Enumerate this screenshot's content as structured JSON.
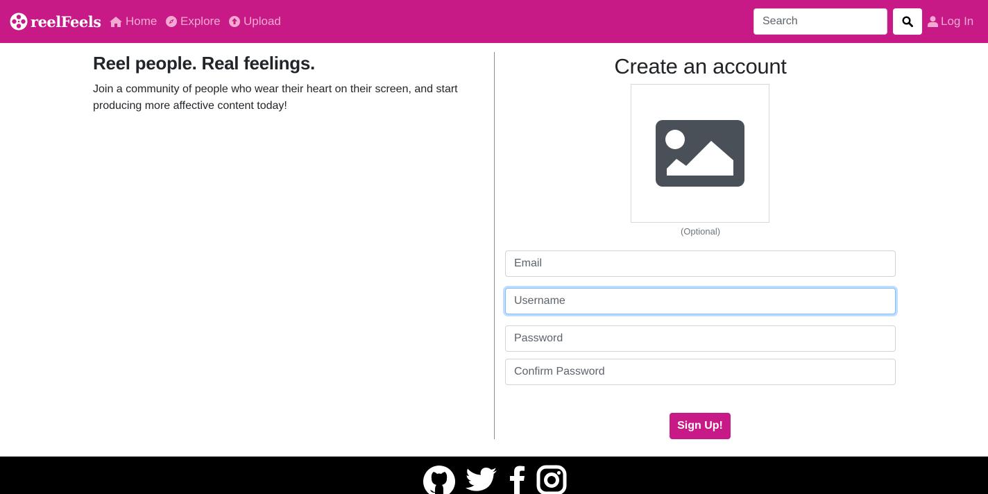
{
  "brand": {
    "name": "reelFeels"
  },
  "nav": {
    "home": "Home",
    "explore": "Explore",
    "upload": "Upload",
    "search_placeholder": "Search",
    "login": "Log In"
  },
  "hero": {
    "title": "Reel people. Real feelings.",
    "text": "Join a community of people who wear their heart on their screen, and start producing more affective content today!"
  },
  "signup": {
    "title": "Create an account",
    "avatar_note": "(Optional)",
    "email_placeholder": "Email",
    "username_placeholder": "Username",
    "password_placeholder": "Password",
    "confirm_placeholder": "Confirm Password",
    "submit_label": "Sign Up!"
  },
  "footer": {
    "icons": [
      "github-icon",
      "twitter-icon",
      "facebook-icon",
      "instagram-icon"
    ]
  },
  "colors": {
    "brand": "#c71a86",
    "nav_link": "#f3a9d2",
    "footer": "#000000",
    "focus": "#80bdff"
  }
}
